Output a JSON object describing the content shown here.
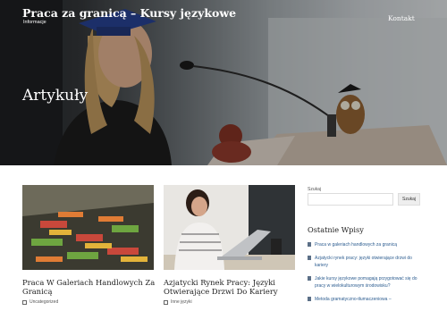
{
  "header": {
    "site_title": "Praca za granicą – Kursy językowe",
    "site_description": "Informacje",
    "nav": [
      {
        "label": "Kontakt"
      }
    ]
  },
  "hero": {
    "heading": "Artykuły"
  },
  "articles": [
    {
      "title": "Praca W Galeriach Handlowych Za Granicą",
      "category": "Uncategorized"
    },
    {
      "title": "Azjatycki Rynek Pracy: Języki Otwierające Drzwi Do Kariery",
      "category": "Inne języki"
    }
  ],
  "sidebar": {
    "search_label": "Szukaj",
    "search_placeholder": "",
    "search_button": "Szukaj",
    "recent_title": "Ostatnie Wpisy",
    "recent_posts": [
      "Praca w galeriach handlowych za granicą",
      "Azjatycki rynek pracy: języki otwierające drzwi do kariery",
      "Jakie kursy językowe pomagają przygotować się do pracy w wielokulturowym środowisku?",
      "Metoda gramatyczno-tłumaczeniowa –"
    ]
  },
  "colors": {
    "link": "#2d5d90",
    "heading": "#222222",
    "hero_overlay": "#141414"
  }
}
